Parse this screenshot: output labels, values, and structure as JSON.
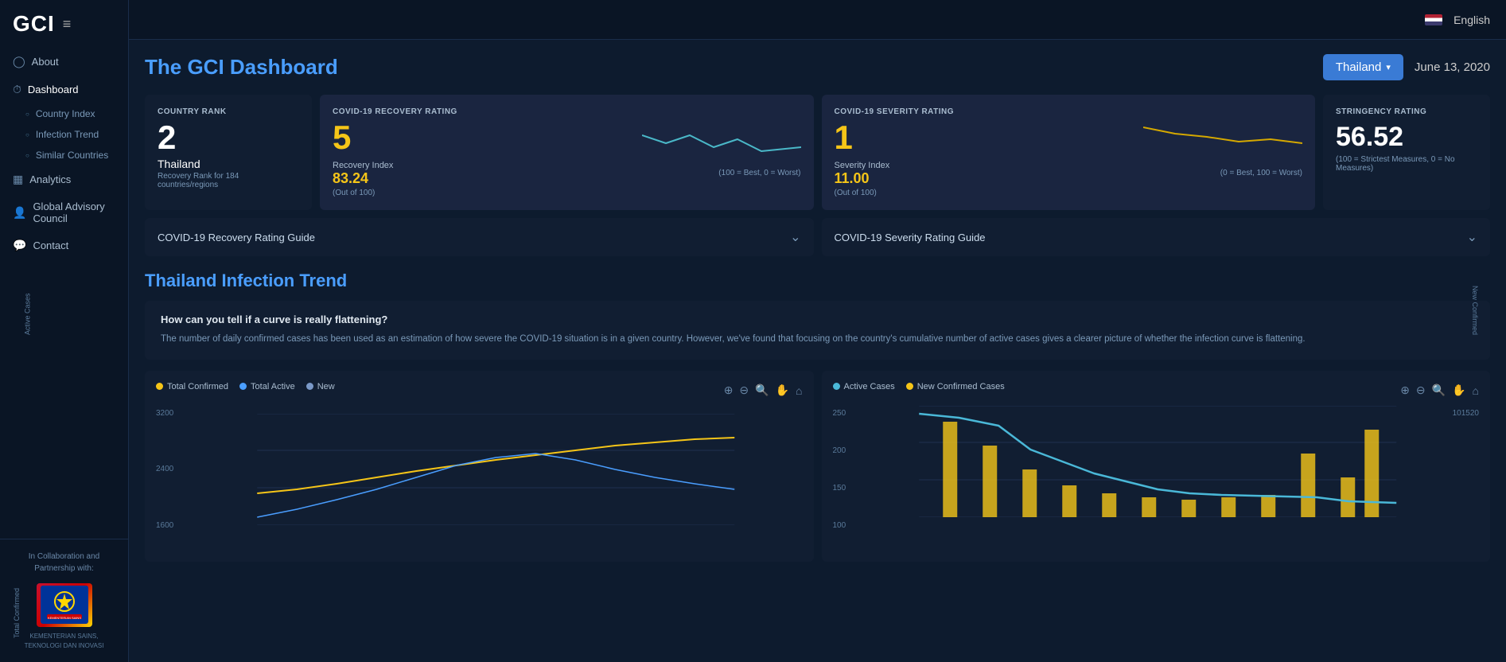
{
  "app": {
    "logo": "GCI",
    "hamburger": "≡"
  },
  "topbar": {
    "language": "English"
  },
  "sidebar": {
    "items": [
      {
        "id": "about",
        "label": "About",
        "icon": "◯",
        "type": "main"
      },
      {
        "id": "dashboard",
        "label": "Dashboard",
        "icon": "⏱",
        "type": "main"
      },
      {
        "id": "country-index",
        "label": "Country Index",
        "type": "sub"
      },
      {
        "id": "infection-trend",
        "label": "Infection Trend",
        "type": "sub"
      },
      {
        "id": "similar-countries",
        "label": "Similar Countries",
        "type": "sub"
      },
      {
        "id": "analytics",
        "label": "Analytics",
        "icon": "▦",
        "type": "main"
      },
      {
        "id": "global-advisory",
        "label": "Global Advisory Council",
        "icon": "👤",
        "type": "main"
      },
      {
        "id": "contact",
        "label": "Contact",
        "icon": "💬",
        "type": "main"
      }
    ],
    "collaboration": "In Collaboration and Partnership with:"
  },
  "header": {
    "title": "The GCI Dashboard",
    "country": "Thailand",
    "date": "June 13, 2020"
  },
  "cards": {
    "rank": {
      "label": "COUNTRY RANK",
      "value": "2",
      "country": "Thailand",
      "sub": "Recovery Rank for 184 countries/regions"
    },
    "recovery": {
      "label": "COVID-19 RECOVERY RATING",
      "value": "5",
      "index_label": "Recovery Index",
      "index_value": "83.24",
      "index_sub": "(Out of 100)",
      "chart_note": "(100 = Best, 0 = Worst)"
    },
    "severity": {
      "label": "COVID-19 SEVERITY RATING",
      "value": "1",
      "index_label": "Severity Index",
      "index_value": "11.00",
      "index_sub": "(Out of 100)",
      "chart_note": "(0 = Best, 100 = Worst)"
    },
    "stringency": {
      "label": "STRINGENCY RATING",
      "value": "56.52",
      "sub": "(100 = Strictest Measures, 0 = No Measures)"
    }
  },
  "guides": {
    "recovery": "COVID-19 Recovery Rating Guide",
    "severity": "COVID-19 Severity Rating Guide"
  },
  "trend": {
    "title": "Thailand Infection Trend",
    "question": "How can you tell if a curve is really flattening?",
    "description": "The number of daily confirmed cases has been used as an estimation of how severe the COVID-19 situation is in a given country. However, we've found that focusing on the country's cumulative number of active cases gives a clearer picture of whether the infection curve is flattening."
  },
  "chart1": {
    "legends": [
      {
        "label": "Total Confirmed",
        "color": "#f5c518"
      },
      {
        "label": "Total Active",
        "color": "#4a9eff"
      },
      {
        "label": "New",
        "color": "#7a99c8"
      }
    ],
    "yLabels": [
      "3200",
      "2400",
      "1600"
    ],
    "toolbar": [
      "⊕",
      "⊖",
      "🔍",
      "✋",
      "⌂"
    ]
  },
  "chart2": {
    "legends": [
      {
        "label": "Active Cases",
        "color": "#4ab8d8"
      },
      {
        "label": "New Confirmed Cases",
        "color": "#f5c518"
      }
    ],
    "yLabels": [
      "250",
      "200",
      "150",
      "100"
    ],
    "yLabels2": [
      "20",
      "15",
      "10"
    ],
    "toolbar": [
      "⊕",
      "⊖",
      "🔍",
      "✋",
      "⌂"
    ]
  }
}
